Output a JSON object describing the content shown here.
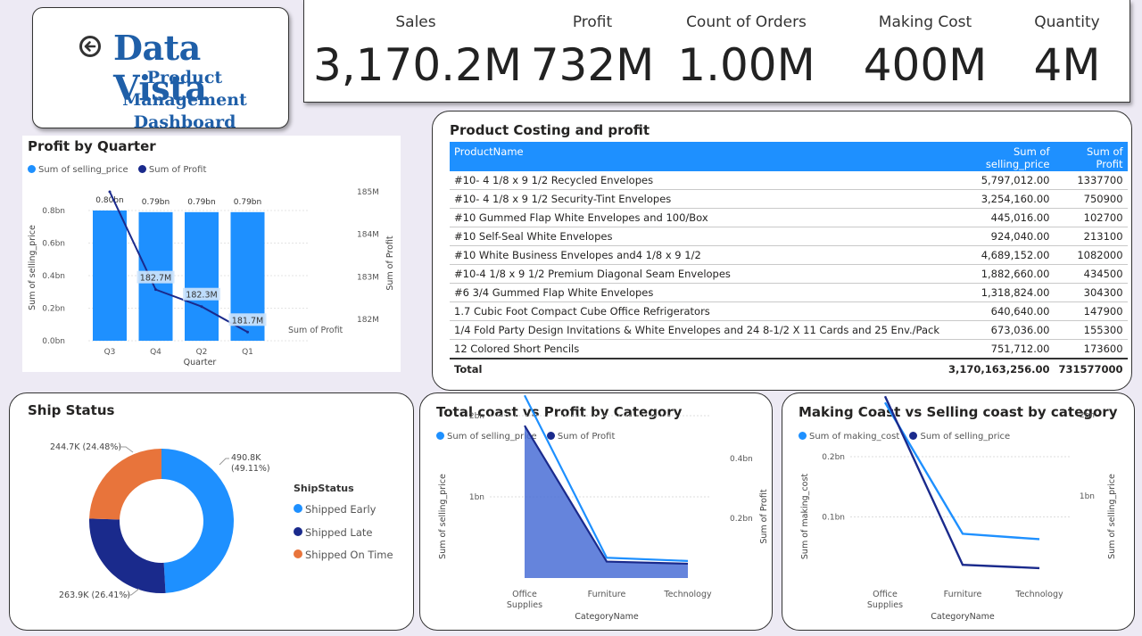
{
  "title": {
    "main": "Data Vista",
    "subtitle": "Product Management Dashboard",
    "back_icon": "back-arrow-icon"
  },
  "kpis": [
    {
      "label": "Sales",
      "value": "3,170.2M"
    },
    {
      "label": "Profit",
      "value": "732M"
    },
    {
      "label": "Count of Orders",
      "value": "1.00M"
    },
    {
      "label": "Making Cost",
      "value": "400M"
    },
    {
      "label": "Quantity",
      "value": "4M"
    }
  ],
  "colors": {
    "accent_light": "#1e90ff",
    "accent_dark": "#1a2a8c",
    "orange": "#e8743b",
    "area_fill": "#4a6fd6"
  },
  "table": {
    "title": "Product Costing and profit",
    "columns": [
      "ProductName",
      "Sum of selling_price",
      "Sum of Profit"
    ],
    "rows": [
      [
        "#10- 4 1/8 x 9 1/2 Recycled Envelopes",
        "5,797,012.00",
        "1337700"
      ],
      [
        "#10- 4 1/8 x 9 1/2 Security-Tint Envelopes",
        "3,254,160.00",
        "750900"
      ],
      [
        "#10 Gummed Flap White Envelopes and 100/Box",
        "445,016.00",
        "102700"
      ],
      [
        "#10 Self-Seal White Envelopes",
        "924,040.00",
        "213100"
      ],
      [
        "#10 White Business Envelopes and4 1/8 x 9 1/2",
        "4,689,152.00",
        "1082000"
      ],
      [
        "#10-4 1/8 x 9 1/2 Premium Diagonal Seam Envelopes",
        "1,882,660.00",
        "434500"
      ],
      [
        "#6 3/4 Gummed Flap White Envelopes",
        "1,318,824.00",
        "304300"
      ],
      [
        "1.7 Cubic Foot Compact Cube Office Refrigerators",
        "640,640.00",
        "147900"
      ],
      [
        "1/4 Fold Party Design Invitations & White Envelopes and 24 8-1/2 X 11 Cards and 25 Env./Pack",
        "673,036.00",
        "155300"
      ],
      [
        "12 Colored Short Pencils",
        "751,712.00",
        "173600"
      ]
    ],
    "total": {
      "label": "Total",
      "selling": "3,170,163,256.00",
      "profit": "731577000"
    }
  },
  "chart_data": [
    {
      "type": "bar",
      "title": "Profit by Quarter",
      "xlabel": "Quarter",
      "ylabel": "Sum of selling_price",
      "y2label": "Sum of Profit",
      "categories": [
        "Q3",
        "Q4",
        "Q2",
        "Q1"
      ],
      "series": [
        {
          "name": "Sum of selling_price",
          "values": [
            0.8,
            0.79,
            0.79,
            0.79
          ],
          "labels": [
            "0.80bn",
            "0.79bn",
            "0.79bn",
            "0.79bn"
          ],
          "axis": "left"
        },
        {
          "name": "Sum of Profit",
          "type": "line",
          "values": [
            185.0,
            182.7,
            182.3,
            181.7
          ],
          "labels": [
            "",
            "182.7M",
            "182.3M",
            "181.7M"
          ],
          "axis": "right"
        }
      ],
      "ylim": [
        0,
        0.8
      ],
      "yticks": [
        "0.0bn",
        "0.2bn",
        "0.4bn",
        "0.6bn",
        "0.8bn"
      ],
      "y2lim": [
        182,
        185
      ],
      "y2ticks": [
        "182M",
        "183M",
        "184M",
        "185M"
      ],
      "legend": "top-left"
    },
    {
      "type": "pie",
      "title": "Ship Status",
      "legend_title": "ShipStatus",
      "categories": [
        "Shipped Early",
        "Shipped Late",
        "Shipped On Time"
      ],
      "values": [
        490.8,
        263.9,
        244.7
      ],
      "labels": [
        "490.8K (49.11%)",
        "263.9K (26.41%)",
        "244.7K (24.48%)"
      ],
      "colors": [
        "#1e90ff",
        "#1a2a8c",
        "#e8743b"
      ],
      "legend": "right"
    },
    {
      "type": "area",
      "title": "Total coast vs Profit by Category",
      "xlabel": "CategoryName",
      "ylabel": "Sum of selling_price",
      "y2label": "Sum of Profit",
      "categories": [
        "Office Supplies",
        "Furniture",
        "Technology"
      ],
      "series": [
        {
          "name": "Sum of selling_price",
          "values": [
            2.25,
            0.25,
            0.21
          ],
          "axis": "left"
        },
        {
          "name": "Sum of Profit",
          "values": [
            0.51,
            0.055,
            0.048
          ],
          "axis": "right"
        }
      ],
      "yticks": [
        "1bn",
        "2bn"
      ],
      "y2ticks": [
        "0.2bn",
        "0.4bn"
      ],
      "legend": "top-left"
    },
    {
      "type": "line",
      "title": "Making Coast vs Selling coast by category",
      "xlabel": "CategoryName",
      "ylabel": "Sum of making_cost",
      "y2label": "Sum of selling_price",
      "categories": [
        "Office Supplies",
        "Furniture",
        "Technology"
      ],
      "series": [
        {
          "name": "Sum of making_cost",
          "values": [
            0.29,
            0.072,
            0.063
          ],
          "axis": "left"
        },
        {
          "name": "Sum of selling_price",
          "values": [
            2.25,
            0.25,
            0.21
          ],
          "axis": "right"
        }
      ],
      "yticks": [
        "0.1bn",
        "0.2bn"
      ],
      "y2ticks": [
        "1bn",
        "2bn"
      ],
      "legend": "top-left"
    }
  ]
}
